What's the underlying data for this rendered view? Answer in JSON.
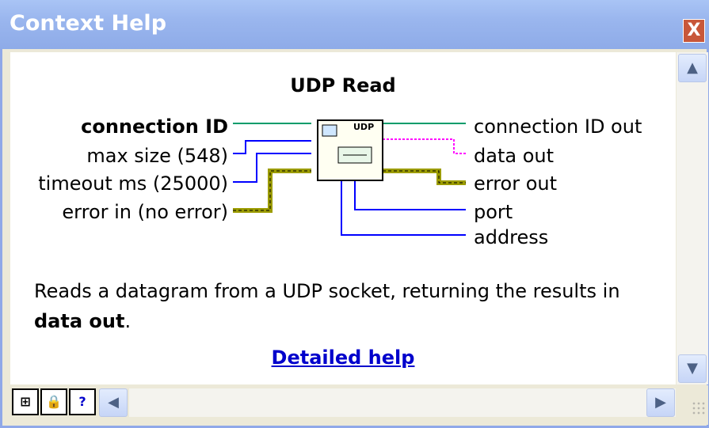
{
  "window": {
    "title": "Context Help",
    "close_label": "X"
  },
  "vi": {
    "title": "UDP Read",
    "icon_label": "UDP",
    "inputs": [
      "connection ID",
      "max size (548)",
      "timeout ms (25000)",
      "error in (no error)"
    ],
    "outputs": [
      "connection ID out",
      "data out",
      "error out",
      "port",
      "address"
    ]
  },
  "description": {
    "text": "Reads a datagram from a UDP socket, returning the results in",
    "bold": "data out",
    "period": "."
  },
  "link": {
    "label": "Detailed help"
  },
  "colors": {
    "titlebar": "#9ab6ee",
    "refnum_wire": "#009c6b",
    "number_wire": "#0000ff",
    "string_wire": "#ff00ff",
    "error_wire": "#9c9c00",
    "link": "#0000cc"
  }
}
